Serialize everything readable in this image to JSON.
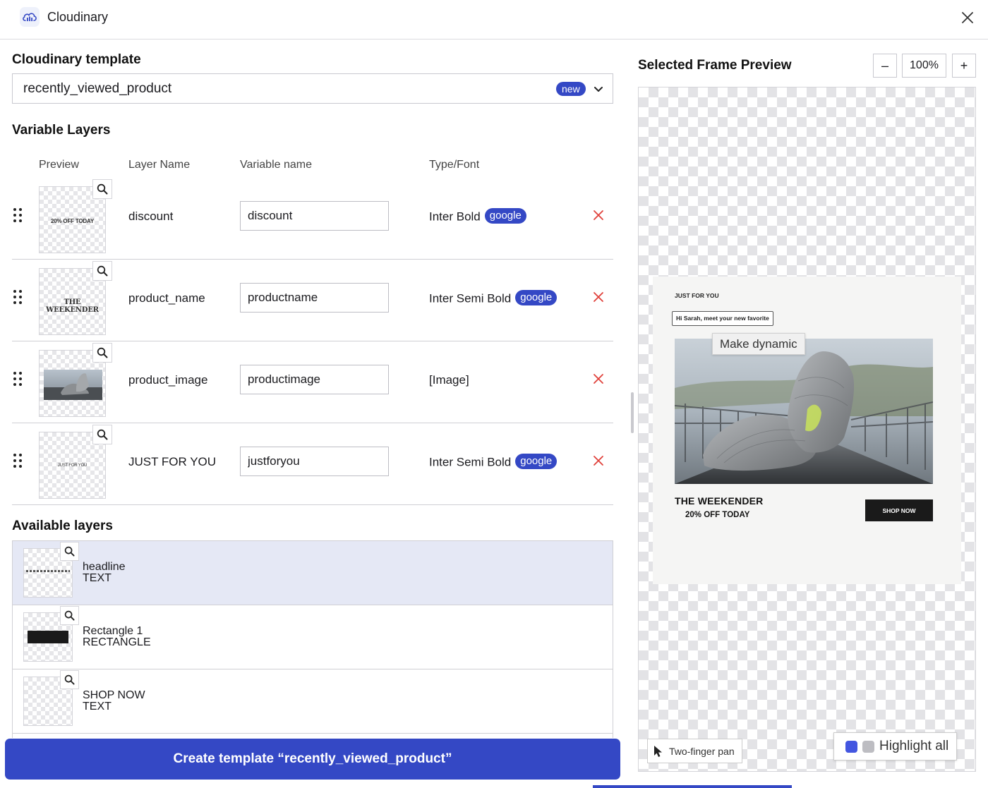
{
  "window": {
    "title": "Cloudinary",
    "logo_icon": "cloudinary-cloud-icon",
    "close_icon": "close-icon"
  },
  "template": {
    "heading": "Cloudinary template",
    "value": "recently_viewed_product",
    "badge": "new"
  },
  "variable_layers": {
    "heading": "Variable Layers",
    "columns": {
      "preview": "Preview",
      "layer_name": "Layer Name",
      "variable_name": "Variable name",
      "type_font": "Type/Font"
    },
    "rows": [
      {
        "thumb_text": "20% OFF TODAY",
        "layer_name": "discount",
        "variable": "discount",
        "font": "Inter Bold",
        "badge": "google"
      },
      {
        "thumb_text": "THE WEEKENDER",
        "layer_name": "product_name",
        "variable": "productname",
        "font": "Inter Semi Bold",
        "badge": "google"
      },
      {
        "thumb_text": "",
        "layer_name": "product_image",
        "variable": "productimage",
        "font": "[Image]",
        "badge": ""
      },
      {
        "thumb_text": "JUST FOR YOU",
        "layer_name": "JUST FOR YOU",
        "variable": "justforyou",
        "font": "Inter Semi Bold",
        "badge": "google"
      }
    ]
  },
  "available_layers": {
    "heading": "Available layers",
    "items": [
      {
        "name": "headline",
        "type": "TEXT",
        "selected": true
      },
      {
        "name": "Rectangle 1",
        "type": "RECTANGLE",
        "selected": false
      },
      {
        "name": "SHOP NOW",
        "type": "TEXT",
        "selected": false
      }
    ]
  },
  "create_button": {
    "label": "Create template “recently_viewed_product”"
  },
  "preview": {
    "title": "Selected Frame Preview",
    "zoom_out": "–",
    "zoom_level": "100%",
    "zoom_in": "+",
    "frame": {
      "just_for_you": "JUST FOR YOU",
      "headline": "Hi Sarah, meet your new favorite",
      "tooltip": "Make dynamic",
      "product": "THE WEEKENDER",
      "discount": "20% OFF TODAY",
      "shop_now": "SHOP NOW"
    },
    "pan_label": "Two-finger pan",
    "highlight_label": "Highlight all"
  },
  "colors": {
    "accent": "#3448c5",
    "remove": "#e0403a",
    "selected_row": "#e5e8f5",
    "swatch_blue": "#4356e0",
    "swatch_gray": "#bdbdc2"
  }
}
